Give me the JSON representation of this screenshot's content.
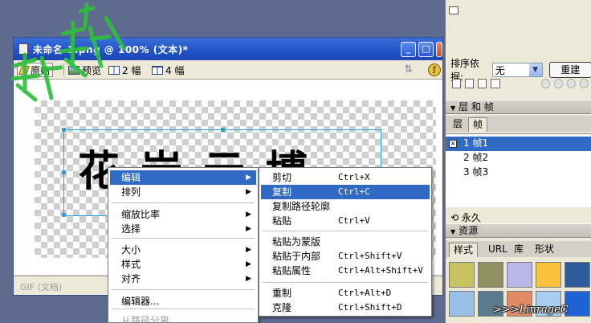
{
  "document": {
    "title": "未命名-1.png @ 100% (文本)*",
    "toolbar": {
      "original": "原始",
      "preview": "预览",
      "two_up": "2 幅",
      "four_up": "4 幅"
    },
    "canvas_text": "花岩云博",
    "status": "GIF (文档)"
  },
  "panel": {
    "sort_label": "排序依据:",
    "sort_value": "无",
    "redo_label": "重建",
    "layers_header": "层 和 帧",
    "tab_layers": "层",
    "tab_frames": "帧",
    "frames": [
      {
        "label": "1  帧1",
        "selected": true
      },
      {
        "label": "2  帧2",
        "selected": false
      },
      {
        "label": "3  帧3",
        "selected": false
      }
    ],
    "loop_label": "永久",
    "assets_header": "资源",
    "asset_tabs": [
      "样式",
      "URL",
      "库",
      "形状"
    ],
    "swatch_colors": [
      "#c9c461",
      "#8f9163",
      "#b7b6e6",
      "#fbc33d",
      "#2c5c9a",
      "#9ac0e8",
      "#5a7a8e",
      "#e08a66",
      "#a8cdf0",
      "#1e62d6"
    ]
  },
  "context_menu": {
    "items": [
      {
        "label": "编辑",
        "submenu": true,
        "highlighted": true
      },
      {
        "label": "排列",
        "submenu": true
      },
      {
        "label": "缩放比率",
        "submenu": true
      },
      {
        "label": "选择",
        "submenu": true
      },
      {
        "label": "大小",
        "submenu": true
      },
      {
        "label": "样式",
        "submenu": true
      },
      {
        "label": "对齐",
        "submenu": true
      },
      {
        "label": "编辑器..."
      },
      {
        "label": "从路径分离",
        "disabled": true
      }
    ]
  },
  "edit_submenu": {
    "items": [
      {
        "label": "剪切",
        "shortcut": "Ctrl+X"
      },
      {
        "label": "复制",
        "shortcut": "Ctrl+C",
        "highlighted": true
      },
      {
        "label": "复制路径轮廓",
        "shortcut": ""
      },
      {
        "label": "粘贴",
        "shortcut": "Ctrl+V"
      },
      {
        "label": "粘贴为蒙版",
        "shortcut": ""
      },
      {
        "label": "粘贴于内部",
        "shortcut": "Ctrl+Shift+V"
      },
      {
        "label": "粘贴属性",
        "shortcut": "Ctrl+Alt+Shift+V"
      },
      {
        "label": "重制",
        "shortcut": "Ctrl+Alt+D"
      },
      {
        "label": "克隆",
        "shortcut": "Ctrl+Shift+D"
      }
    ]
  },
  "watermark_text": "花岩",
  "signature": ">>>LinrageC"
}
